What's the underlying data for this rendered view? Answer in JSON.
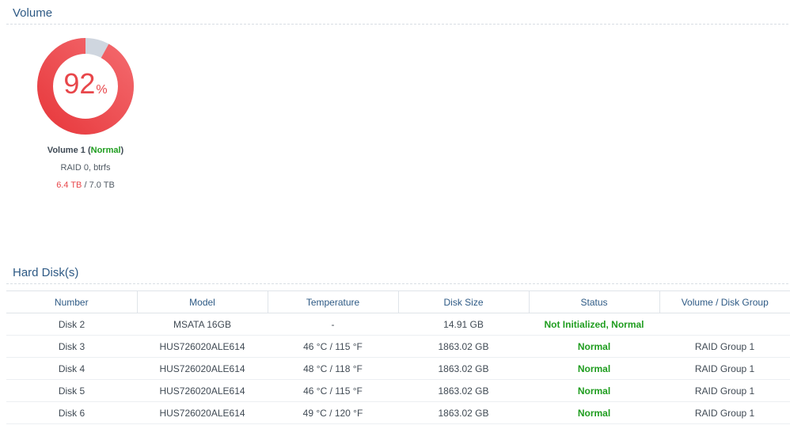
{
  "volume_section": {
    "title": "Volume"
  },
  "volume": {
    "usage_number": "92",
    "usage_unit": "%",
    "usage_fraction": 0.92,
    "name": "Volume 1",
    "open_paren": " (",
    "status": "Normal",
    "close_paren": ")",
    "raid_info": "RAID 0, btrfs",
    "used": "6.4 TB",
    "separator": " / ",
    "total": "7.0 TB",
    "colors": {
      "used": "#e8474b",
      "free": "#cfd6df",
      "status_ok": "#1f9d1f"
    }
  },
  "disks_section": {
    "title": "Hard Disk(s)"
  },
  "disks_table": {
    "headers": [
      "Number",
      "Model",
      "Temperature",
      "Disk Size",
      "Status",
      "Volume / Disk Group"
    ],
    "rows": [
      {
        "number": "Disk 2",
        "model": "MSATA 16GB",
        "temperature": "-",
        "size": "14.91 GB",
        "status": "Not Initialized, Normal",
        "group": ""
      },
      {
        "number": "Disk 3",
        "model": "HUS726020ALE614",
        "temperature": "46 °C / 115 °F",
        "size": "1863.02 GB",
        "status": "Normal",
        "group": "RAID Group 1"
      },
      {
        "number": "Disk 4",
        "model": "HUS726020ALE614",
        "temperature": "48 °C / 118 °F",
        "size": "1863.02 GB",
        "status": "Normal",
        "group": "RAID Group 1"
      },
      {
        "number": "Disk 5",
        "model": "HUS726020ALE614",
        "temperature": "46 °C / 115 °F",
        "size": "1863.02 GB",
        "status": "Normal",
        "group": "RAID Group 1"
      },
      {
        "number": "Disk 6",
        "model": "HUS726020ALE614",
        "temperature": "49 °C / 120 °F",
        "size": "1863.02 GB",
        "status": "Normal",
        "group": "RAID Group 1"
      }
    ]
  }
}
